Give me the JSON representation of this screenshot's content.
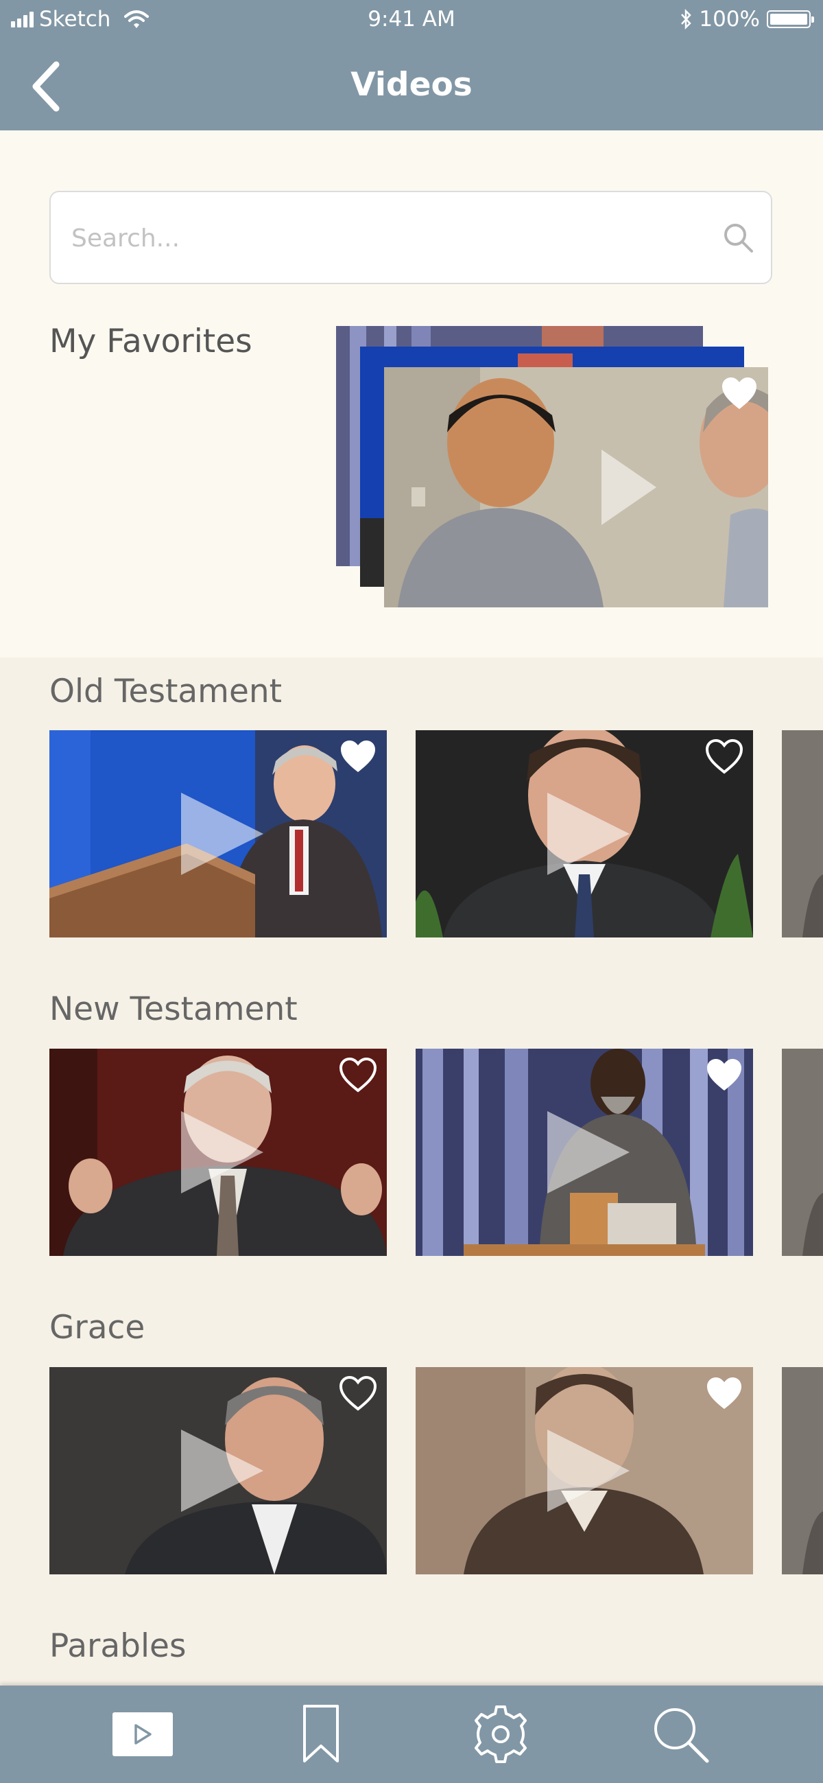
{
  "status_bar": {
    "carrier": "Sketch",
    "time": "9:41 AM",
    "battery": "100%"
  },
  "nav": {
    "title": "Videos"
  },
  "search": {
    "placeholder": "Search..."
  },
  "favorites": {
    "label": "My Favorites"
  },
  "sections": [
    {
      "title": "Old Testament",
      "videos": [
        {
          "favorited": true
        },
        {
          "favorited": false
        }
      ]
    },
    {
      "title": "New Testament",
      "videos": [
        {
          "favorited": false
        },
        {
          "favorited": true
        }
      ]
    },
    {
      "title": "Grace",
      "videos": [
        {
          "favorited": false
        },
        {
          "favorited": true
        }
      ]
    },
    {
      "title": "Parables"
    }
  ],
  "tabs": [
    {
      "icon": "video-play-icon",
      "active": true
    },
    {
      "icon": "bookmark-icon",
      "active": false
    },
    {
      "icon": "gear-icon",
      "active": false
    },
    {
      "icon": "search-icon",
      "active": false
    }
  ],
  "colors": {
    "bar": "#8297a5",
    "background": "#f6f1e6",
    "top_background": "#fcf9f1"
  }
}
